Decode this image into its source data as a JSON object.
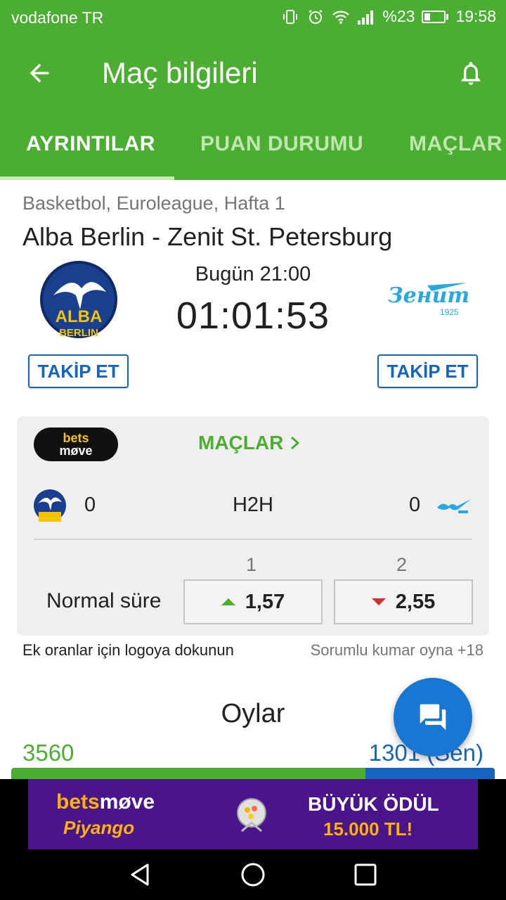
{
  "status_bar": {
    "carrier": "vodafone TR",
    "battery": "%23",
    "time": "19:58",
    "icons": [
      "vibrate-icon",
      "alarm-icon",
      "wifi-icon",
      "signal-icon",
      "battery-icon"
    ]
  },
  "app_bar": {
    "title": "Maç bilgileri",
    "back_icon": "arrow-left-icon",
    "bell_icon": "bell-icon"
  },
  "tabs": [
    {
      "label": "AYRINTILAR",
      "active": true
    },
    {
      "label": "PUAN DURUMU",
      "active": false
    },
    {
      "label": "MAÇLAR",
      "active": false
    }
  ],
  "match": {
    "league": "Basketbol, Euroleague, Hafta 1",
    "title": "Alba Berlin - Zenit St. Petersburg",
    "kickoff": "Bugün 21:00",
    "countdown": "01:01:53",
    "home_logo_text": [
      "ALBA",
      "BERLIN"
    ],
    "away_logo_text": [
      "Зенит",
      "1925"
    ],
    "follow_home": "TAKİP ET",
    "follow_away": "TAKİP ET"
  },
  "odds": {
    "bookmaker": {
      "line1": "bets",
      "line2": "møve"
    },
    "matches_link": "MAÇLAR",
    "h2h": {
      "home": "0",
      "label": "H2H",
      "away": "0"
    },
    "col1": "1",
    "col2": "2",
    "market": "Normal süre",
    "odd1": {
      "value": "1,57",
      "trend": "up"
    },
    "odd2": {
      "value": "2,55",
      "trend": "down"
    }
  },
  "hints": {
    "left": "Ek oranlar için logoya dokunun",
    "right": "Sorumlu kumar oyna +18"
  },
  "votes": {
    "title": "Oylar",
    "home": "3560",
    "away": "1301 (Sen)",
    "home_share": 0.732
  },
  "ad": {
    "brand1": "bets",
    "brand2": "møve",
    "sub": "Piyango",
    "prize1": "BÜYÜK ÖDÜL",
    "prize2": "15.000 TL!"
  },
  "colors": {
    "primary_green": "#4cad33",
    "link_blue": "#1565c0",
    "fab_blue": "#1976d2",
    "down_red": "#d32f2f"
  }
}
